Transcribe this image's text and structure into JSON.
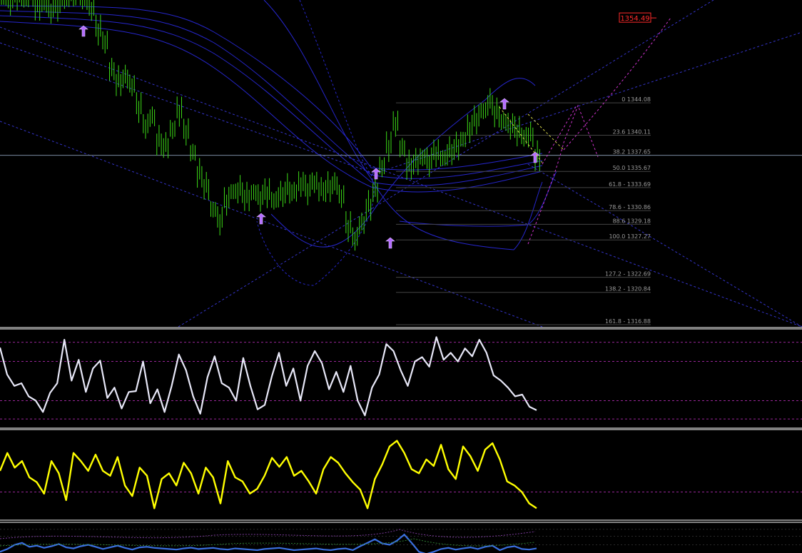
{
  "chart_data": {
    "type": "line",
    "panes": [
      {
        "name": "main",
        "kind": "bars"
      },
      {
        "name": "oscillator-1",
        "kind": "line"
      },
      {
        "name": "oscillator-2",
        "kind": "line"
      },
      {
        "name": "oscillator-3",
        "kind": "line"
      }
    ],
    "price_axis": {
      "min": 1314,
      "max": 1358
    },
    "price_label": {
      "text": "1354.49",
      "value": 1354.49
    },
    "fib_levels": [
      {
        "label": "0 1344.08",
        "value": 1344.08
      },
      {
        "label": "23.6 1340.11",
        "value": 1340.11
      },
      {
        "label": "38.2 1337.65",
        "value": 1337.65
      },
      {
        "label": "50.0 1335.67",
        "value": 1335.67
      },
      {
        "label": "61.8 - 1333.69",
        "value": 1333.69
      },
      {
        "label": "78.6 - 1330.86",
        "value": 1330.86
      },
      {
        "label": "88.6 1329.18",
        "value": 1329.18
      },
      {
        "label": "100.0 1327.27",
        "value": 1327.27
      },
      {
        "label": "127.2 - 1322.69",
        "value": 1322.69
      },
      {
        "label": "138.2 - 1320.84",
        "value": 1320.84
      },
      {
        "label": "161.8 - 1316.88",
        "value": 1316.88
      }
    ],
    "current_price": 1337.65,
    "price_series": [
      1357,
      1356.5,
      1357.2,
      1356.8,
      1357.5,
      1356,
      1356.3,
      1355.4,
      1355.9,
      1356.8,
      1357.4,
      1357.9,
      1356.8,
      1355.6,
      1353,
      1351.5,
      1348.2,
      1346.8,
      1347.3,
      1346.2,
      1343.5,
      1341.2,
      1342.4,
      1339.5,
      1338.9,
      1340.8,
      1343,
      1340.5,
      1338,
      1335.5,
      1333.9,
      1331,
      1329.6,
      1332,
      1333.2,
      1333.5,
      1332.6,
      1333.1,
      1332.4,
      1333,
      1332.1,
      1332.9,
      1333.6,
      1333.2,
      1334.1,
      1333.4,
      1334.3,
      1333.5,
      1333.8,
      1334.2,
      1332.6,
      1328.9,
      1327.4,
      1329.3,
      1331.5,
      1333.4,
      1336.2,
      1338.7,
      1341.5,
      1338.6,
      1336.5,
      1336.9,
      1337.4,
      1336.8,
      1337.9,
      1337.3,
      1338.2,
      1338.8,
      1339.6,
      1340.9,
      1342,
      1343.1,
      1344.2,
      1342.9,
      1341.8,
      1341.2,
      1340.6,
      1339.9,
      1340.2,
      1337.6
    ],
    "oscillator_1": [
      0.86,
      0.55,
      0.42,
      0.45,
      0.3,
      0.25,
      0.12,
      0.34,
      0.45,
      0.95,
      0.48,
      0.72,
      0.35,
      0.62,
      0.71,
      0.28,
      0.4,
      0.16,
      0.35,
      0.36,
      0.7,
      0.22,
      0.38,
      0.12,
      0.42,
      0.78,
      0.6,
      0.3,
      0.1,
      0.52,
      0.76,
      0.45,
      0.4,
      0.25,
      0.74,
      0.42,
      0.15,
      0.2,
      0.53,
      0.8,
      0.42,
      0.62,
      0.25,
      0.65,
      0.82,
      0.68,
      0.38,
      0.58,
      0.35,
      0.65,
      0.25,
      0.08,
      0.4,
      0.55,
      0.9,
      0.82,
      0.6,
      0.42,
      0.7,
      0.75,
      0.64,
      0.98,
      0.72,
      0.8,
      0.7,
      0.85,
      0.76,
      0.95,
      0.8,
      0.54,
      0.48,
      0.4,
      0.3,
      0.32,
      0.18,
      0.14
    ],
    "oscillator_2": [
      0.58,
      0.8,
      0.62,
      0.7,
      0.5,
      0.44,
      0.3,
      0.7,
      0.55,
      0.22,
      0.8,
      0.7,
      0.58,
      0.78,
      0.58,
      0.52,
      0.75,
      0.4,
      0.27,
      0.62,
      0.52,
      0.12,
      0.48,
      0.55,
      0.4,
      0.68,
      0.55,
      0.3,
      0.62,
      0.5,
      0.18,
      0.7,
      0.5,
      0.45,
      0.3,
      0.36,
      0.52,
      0.74,
      0.63,
      0.75,
      0.52,
      0.58,
      0.45,
      0.3,
      0.6,
      0.75,
      0.68,
      0.55,
      0.44,
      0.35,
      0.12,
      0.48,
      0.66,
      0.88,
      0.95,
      0.8,
      0.6,
      0.55,
      0.72,
      0.64,
      0.9,
      0.6,
      0.48,
      0.88,
      0.76,
      0.58,
      0.84,
      0.92,
      0.72,
      0.45,
      0.4,
      0.32,
      0.18,
      0.12
    ],
    "oscillator_3": [
      0.3,
      0.4,
      0.55,
      0.62,
      0.48,
      0.52,
      0.44,
      0.5,
      0.58,
      0.46,
      0.42,
      0.5,
      0.55,
      0.48,
      0.4,
      0.46,
      0.52,
      0.44,
      0.38,
      0.46,
      0.48,
      0.44,
      0.42,
      0.4,
      0.38,
      0.42,
      0.45,
      0.4,
      0.42,
      0.44,
      0.4,
      0.38,
      0.42,
      0.4,
      0.38,
      0.36,
      0.4,
      0.42,
      0.44,
      0.4,
      0.36,
      0.38,
      0.4,
      0.42,
      0.38,
      0.36,
      0.4,
      0.42,
      0.36,
      0.5,
      0.62,
      0.75,
      0.6,
      0.55,
      0.7,
      0.92,
      0.62,
      0.3,
      0.22,
      0.3,
      0.4,
      0.44,
      0.38,
      0.42,
      0.46,
      0.4,
      0.48,
      0.52,
      0.36,
      0.46,
      0.5,
      0.4,
      0.38,
      0.42
    ],
    "colors": {
      "background": "#000000",
      "bars": "#3ddc17",
      "bands": "#2626cc",
      "trendlines": "#3a3ae0",
      "fib": "#444444",
      "projection": "#cc33cc",
      "oscillator_1": "#e8e8f8",
      "oscillator_2": "#ffff00",
      "oscillator_3": "#3a6fe0",
      "separator": "#ffffff",
      "price_label": "#ff2a2a",
      "arrow_marker": "#b46cff"
    }
  }
}
